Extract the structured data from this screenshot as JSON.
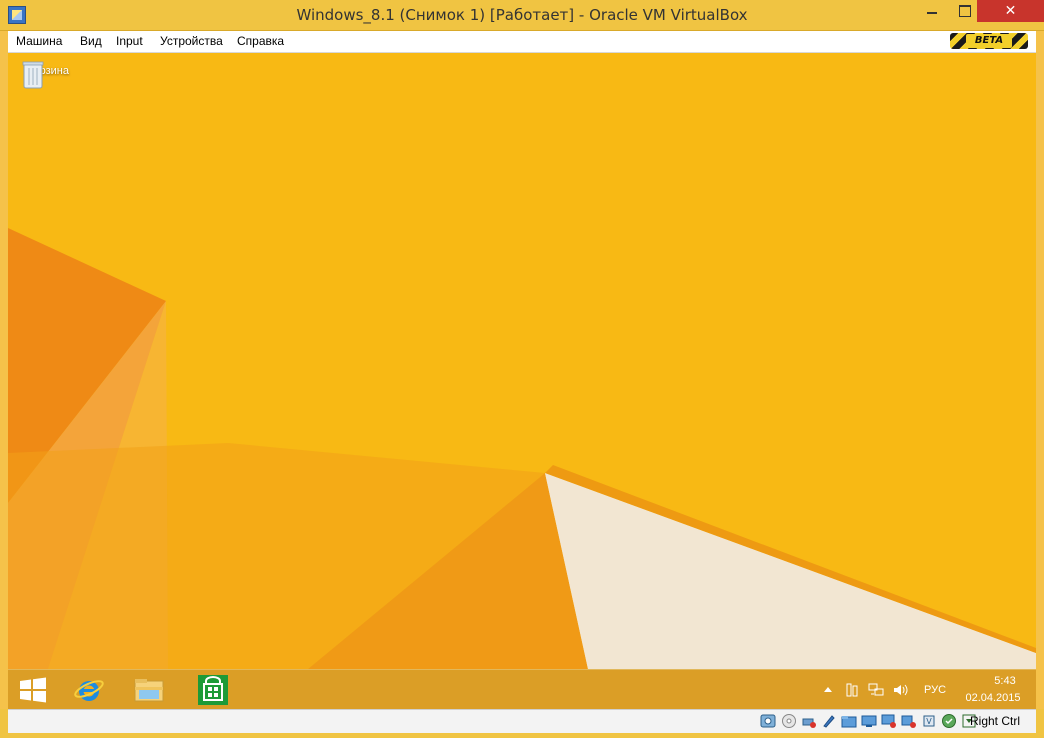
{
  "window": {
    "title": "Windows_8.1 (Снимок 1) [Работает] - Oracle VM VirtualBox",
    "close_glyph": "✕"
  },
  "menu": {
    "items": [
      "Машина",
      "Вид",
      "Input",
      "Устройства",
      "Справка"
    ],
    "badge": "BETA"
  },
  "desktop": {
    "recycle_bin_label": "Корзина",
    "wallpaper_colors": [
      "#f7b60f",
      "#f29a10",
      "#ee7e17",
      "#f3e3c8"
    ]
  },
  "taskbar": {
    "pinned": [
      "start-icon",
      "internet-explorer-icon",
      "file-explorer-icon",
      "store-icon"
    ],
    "tray": {
      "language": "РУС",
      "time": "5:43",
      "date": "02.04.2015"
    }
  },
  "statusbar": {
    "host_key": "Right Ctrl",
    "icons": [
      "hard-disk-icon",
      "optical-drive-icon",
      "usb-icon",
      "audio-icon",
      "shared-folder-icon",
      "display-icon",
      "network-icon",
      "video-capture-icon",
      "cpu-icon",
      "mouse-integration-icon",
      "keyboard-capture-icon"
    ]
  }
}
